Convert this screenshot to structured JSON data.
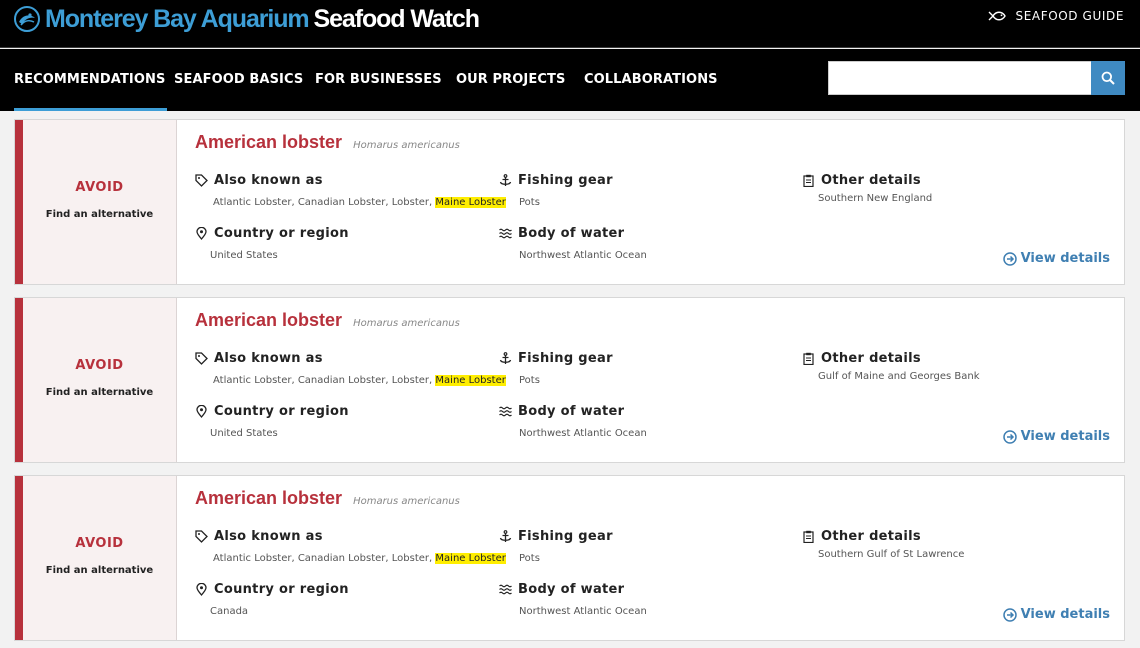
{
  "header": {
    "logo_primary": "Monterey Bay Aquarium",
    "logo_secondary": "Seafood Watch",
    "guide_label": "SEAFOOD GUIDE"
  },
  "nav": {
    "items": [
      {
        "label": "RECOMMENDATIONS",
        "active": true
      },
      {
        "label": "SEAFOOD BASICS"
      },
      {
        "label": "FOR BUSINESSES"
      },
      {
        "label": "OUR PROJECTS"
      },
      {
        "label": "COLLABORATIONS"
      }
    ],
    "search": {
      "value": "",
      "placeholder": ""
    }
  },
  "labels": {
    "also_known_as": "Also known as",
    "fishing_gear": "Fishing gear",
    "other_details": "Other details",
    "country_or_region": "Country or region",
    "body_of_water": "Body of water",
    "view_details": "View details"
  },
  "accent_colors": {
    "avoid": "#b7313c",
    "link": "#3f7fb2",
    "brand_blue": "#3d9ed6",
    "highlight": "#ffee00"
  },
  "cards": [
    {
      "rating": "AVOID",
      "rating_note": "Find an alternative",
      "common_name": "American lobster",
      "scientific_name": "Homarus americanus",
      "aka": "Atlantic Lobster, Canadian Lobster, Lobster,",
      "aka_highlight": "Maine Lobster",
      "fishing_gear": "Pots",
      "other_details": "Southern New England",
      "country": "United States",
      "body_of_water": "Northwest Atlantic Ocean"
    },
    {
      "rating": "AVOID",
      "rating_note": "Find an alternative",
      "common_name": "American lobster",
      "scientific_name": "Homarus americanus",
      "aka": "Atlantic Lobster, Canadian Lobster, Lobster,",
      "aka_highlight": "Maine Lobster",
      "fishing_gear": "Pots",
      "other_details": "Gulf of Maine and Georges Bank",
      "country": "United States",
      "body_of_water": "Northwest Atlantic Ocean"
    },
    {
      "rating": "AVOID",
      "rating_note": "Find an alternative",
      "common_name": "American lobster",
      "scientific_name": "Homarus americanus",
      "aka": "Atlantic Lobster, Canadian Lobster, Lobster,",
      "aka_highlight": "Maine Lobster",
      "fishing_gear": "Pots",
      "other_details": "Southern Gulf of St Lawrence",
      "country": "Canada",
      "body_of_water": "Northwest Atlantic Ocean"
    }
  ]
}
